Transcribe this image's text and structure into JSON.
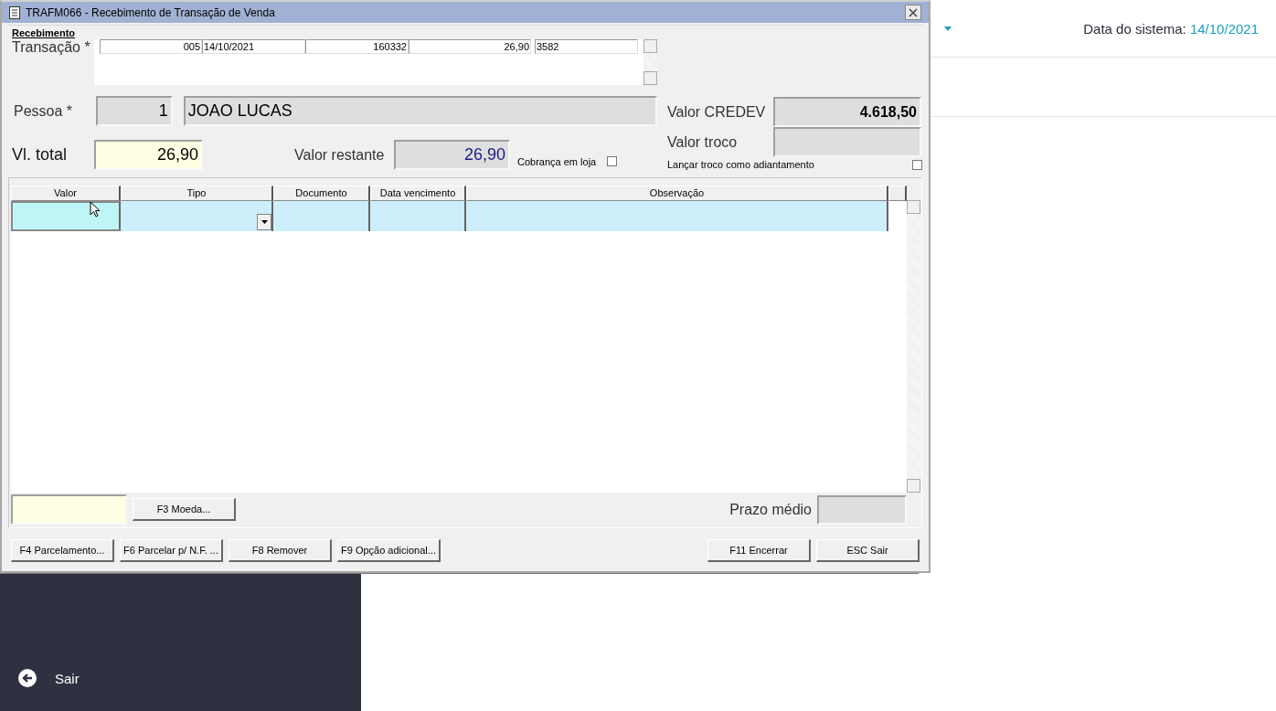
{
  "background": {
    "system_date_label": "Data do sistema:",
    "system_date": "14/10/2021",
    "exit_label": "Sair"
  },
  "window": {
    "title": "TRAFM066 - Recebimento de Transação de Venda"
  },
  "group": {
    "title": "Recebimento"
  },
  "transacao": {
    "label": "Transação *",
    "cells": [
      {
        "text": "005",
        "kind": "number"
      },
      {
        "text": "14/10/2021",
        "kind": "text"
      },
      {
        "text": "160332",
        "kind": "number"
      },
      {
        "text": "26,90",
        "kind": "number"
      },
      {
        "text": "3582",
        "kind": "text"
      }
    ]
  },
  "pessoa": {
    "label": "Pessoa *",
    "code": "1",
    "name": "JOAO LUCAS"
  },
  "valor_credev": {
    "label": "Valor CREDEV",
    "value": "4.618,50"
  },
  "valor_troco": {
    "label": "Valor troco"
  },
  "vl_total": {
    "label": "Vl. total",
    "value": "26,90"
  },
  "valor_restante": {
    "label": "Valor restante",
    "value": "26,90"
  },
  "cobranca_em_loja": {
    "label": "Cobrança em loja",
    "checked": false
  },
  "lancar_troco": {
    "label": "Lançar troco como adiantamento",
    "checked": false
  },
  "grid": {
    "columns": [
      "Valor",
      "Tipo",
      "Documento",
      "Data vencimento",
      "Observação"
    ]
  },
  "currency_button": "F3 Moeda...",
  "prazo_medio": {
    "label": "Prazo médio"
  },
  "buttons_left": [
    "F4 Parcelamento...",
    "F6 Parcelar p/ N.F. ...",
    "F8 Remover",
    "F9 Opção adicional..."
  ],
  "buttons_right": [
    "F11 Encerrar",
    "ESC Sair"
  ]
}
